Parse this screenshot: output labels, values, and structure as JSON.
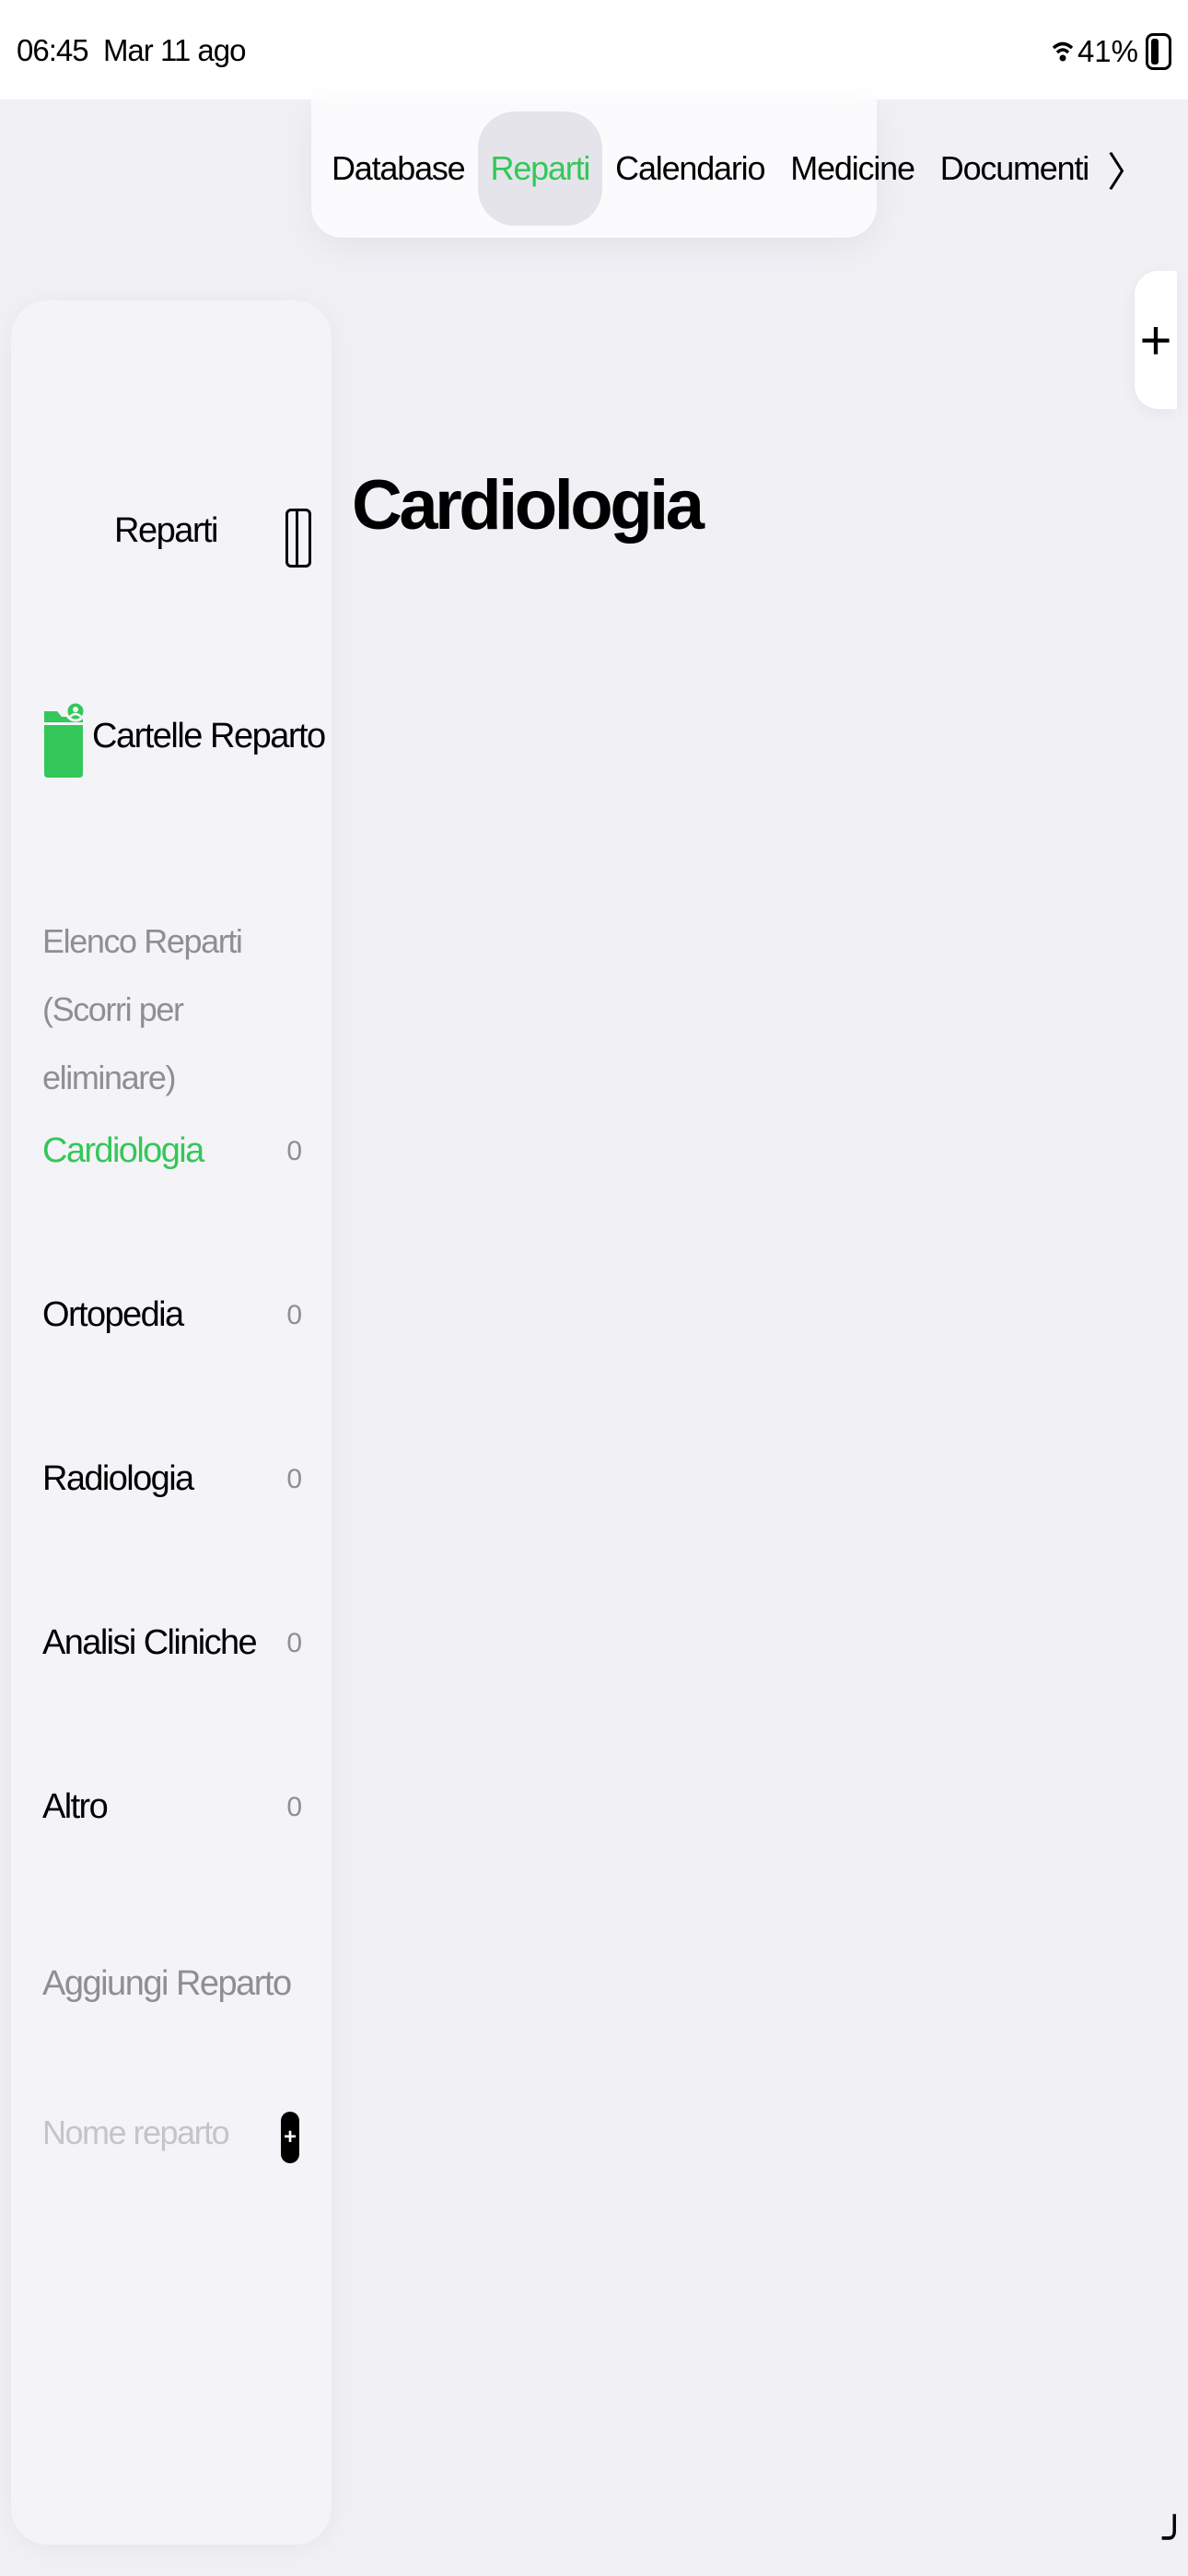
{
  "status_bar": {
    "time": "06:45",
    "date": "Mar 11 ago",
    "battery": "41%"
  },
  "tabs": [
    {
      "label": "Database",
      "active": false
    },
    {
      "label": "Reparti",
      "active": true
    },
    {
      "label": "Calendario",
      "active": false
    },
    {
      "label": "Medicine",
      "active": false
    },
    {
      "label": "Documenti",
      "active": false
    }
  ],
  "tab_more_glyph": "〉",
  "sidebar": {
    "title": "Reparti",
    "folder_label": "Cartelle Reparto",
    "list_header": "Elenco Reparti (Scorri per eliminare)",
    "departments": [
      {
        "name": "Cardiologia",
        "count": "0",
        "selected": true
      },
      {
        "name": "Ortopedia",
        "count": "0",
        "selected": false
      },
      {
        "name": "Radiologia",
        "count": "0",
        "selected": false
      },
      {
        "name": "Analisi Cliniche",
        "count": "0",
        "selected": false
      },
      {
        "name": "Altro",
        "count": "0",
        "selected": false
      }
    ],
    "add_header": "Aggiungi Reparto",
    "add_placeholder": "Nome reparto",
    "add_button_glyph": "+"
  },
  "detail": {
    "title": "Cardiologia"
  },
  "add_glyph": "+",
  "resize_glyph": "╯",
  "colors": {
    "accent": "#34C759",
    "background": "#F1F0F5",
    "secondary_text": "#8E8E93"
  }
}
